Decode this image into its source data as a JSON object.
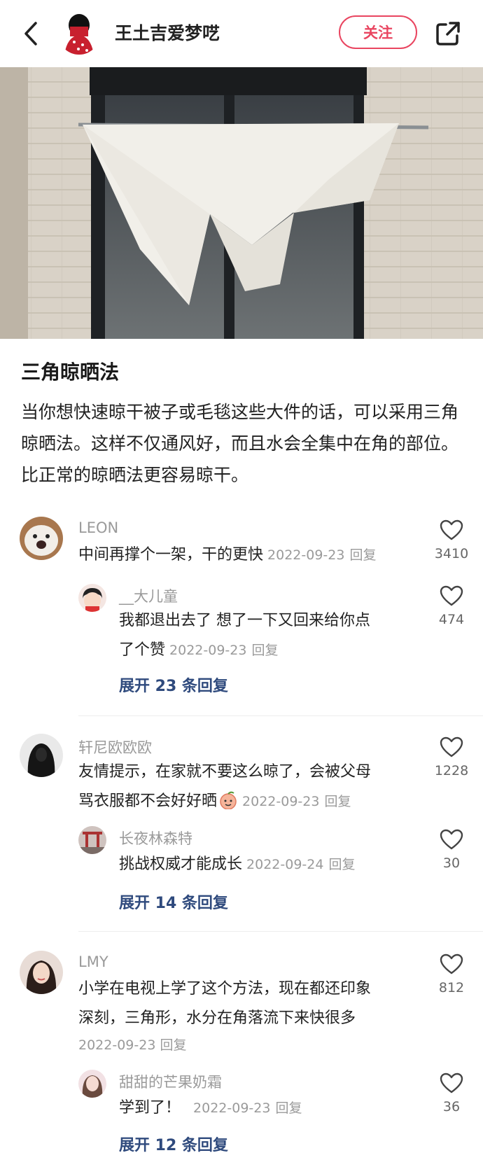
{
  "header": {
    "author_name": "王土吉爱梦呓",
    "follow_label": "关注"
  },
  "post": {
    "title": "三角晾晒法",
    "body": "当你想快速晾干被子或毛毯这些大件的话，可以采用三角晾晒法。这样不仅通风好，而且水会全集中在角的部位。比正常的晾晒法更容易晾干。"
  },
  "comments": [
    {
      "name": "LEON",
      "text": "中间再撑个一架，干的更快",
      "date": "2022-09-23",
      "reply_label": "回复",
      "likes": "3410",
      "reply": {
        "name": "__大儿童",
        "text_line1": "我都退出去了 想了一下又回来给你点",
        "text_line2": "了个赞",
        "date": "2022-09-23",
        "reply_label": "回复",
        "likes": "474"
      },
      "expand": "展开 23 条回复"
    },
    {
      "name": "轩尼欧欧欧",
      "text_line1": "友情提示，在家就不要这么晾了，会被父母",
      "text_line2": "骂衣服都不会好好晒",
      "date": "2022-09-23",
      "reply_label": "回复",
      "likes": "1228",
      "reply": {
        "name": "长夜林森特",
        "text": "挑战权威才能成长",
        "date": "2022-09-24",
        "reply_label": "回复",
        "likes": "30"
      },
      "expand": "展开 14 条回复"
    },
    {
      "name": "LMY",
      "text_line1": "小学在电视上学了这个方法，现在都还印象",
      "text_line2": "深刻，三角形，水分在角落流下来快很多",
      "date": "2022-09-23",
      "reply_label": "回复",
      "likes": "812",
      "reply": {
        "name": "甜甜的芒果奶霜",
        "text": "学到了！",
        "date": "2022-09-23",
        "reply_label": "回复",
        "likes": "36"
      },
      "expand": "展开 12 条回复"
    }
  ],
  "colors": {
    "accent": "#e94560",
    "link": "#2f4a7d"
  },
  "icons": [
    "back-arrow-icon",
    "share-icon",
    "heart-icon"
  ]
}
